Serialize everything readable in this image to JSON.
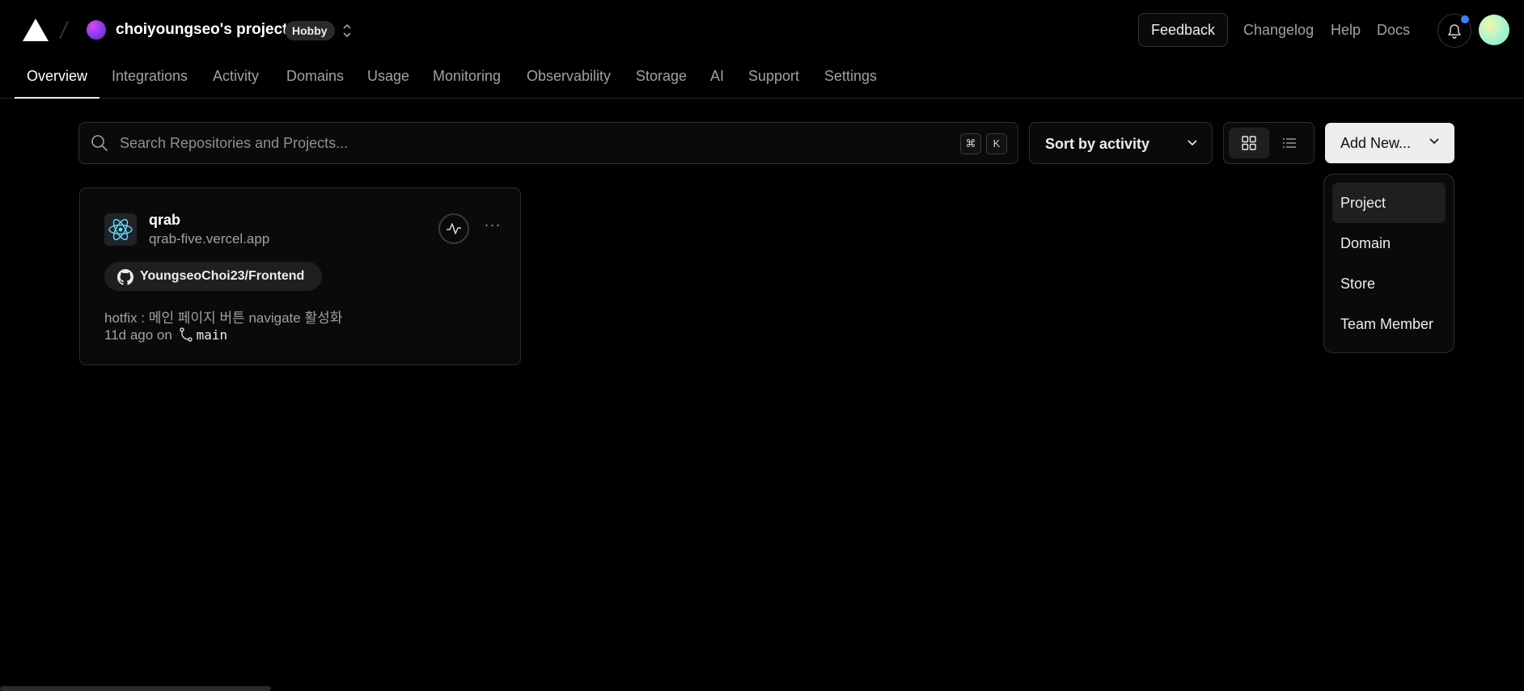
{
  "header": {
    "team_name": "choiyoungseo's projects",
    "plan_badge": "Hobby",
    "feedback_label": "Feedback",
    "changelog_label": "Changelog",
    "help_label": "Help",
    "docs_label": "Docs"
  },
  "tabs": [
    {
      "label": "Overview",
      "active": true
    },
    {
      "label": "Integrations"
    },
    {
      "label": "Activity"
    },
    {
      "label": "Domains"
    },
    {
      "label": "Usage"
    },
    {
      "label": "Monitoring"
    },
    {
      "label": "Observability"
    },
    {
      "label": "Storage"
    },
    {
      "label": "AI"
    },
    {
      "label": "Support"
    },
    {
      "label": "Settings"
    }
  ],
  "search": {
    "placeholder": "Search Repositories and Projects...",
    "shortcut_mod": "⌘",
    "shortcut_key": "K"
  },
  "sort": {
    "selected": "Sort by activity"
  },
  "view_toggle": {
    "active": "grid"
  },
  "add_new": {
    "label": "Add New...",
    "menu_items": [
      "Project",
      "Domain",
      "Store",
      "Team Member"
    ]
  },
  "projects": [
    {
      "name": "qrab",
      "url": "qrab-five.vercel.app",
      "framework_icon": "react-icon",
      "repo": "YoungseoChoi23/Frontend",
      "commit_message": "hotfix : 메인 페이지 버튼 navigate 활성화",
      "commit_age": "11d ago on",
      "branch": "main"
    }
  ],
  "colors": {
    "background": "#000000",
    "accent_dot": "#3b82f6",
    "primary_button": "#ededed"
  }
}
